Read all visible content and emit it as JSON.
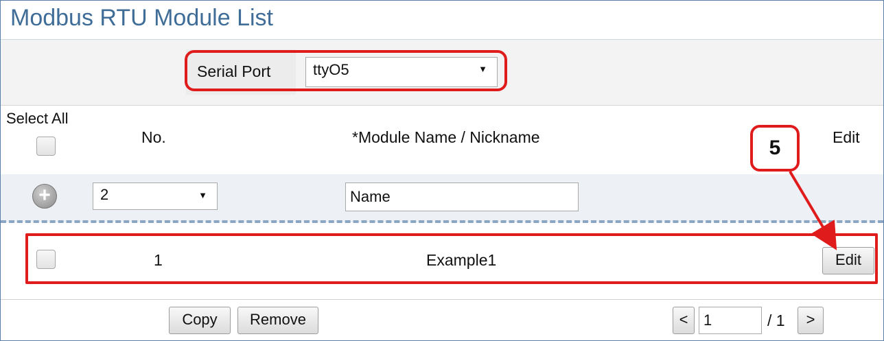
{
  "title": "Modbus RTU Module List",
  "serial_port": {
    "label": "Serial Port",
    "value": "ttyO5"
  },
  "header": {
    "select_all": "Select All",
    "no": "No.",
    "module_name": "*Module Name / Nickname",
    "edit": "Edit"
  },
  "add_row": {
    "number": "2",
    "name": "Name"
  },
  "rows": [
    {
      "no": "1",
      "name": "Example1",
      "edit_label": "Edit"
    }
  ],
  "footer": {
    "copy": "Copy",
    "remove": "Remove",
    "prev": "<",
    "page": "1",
    "total": "/ 1",
    "next": ">"
  },
  "callout": "5",
  "colors": {
    "title": "#3f6d97",
    "highlight": "#e01b1b",
    "dash": "#8ba6c2"
  }
}
